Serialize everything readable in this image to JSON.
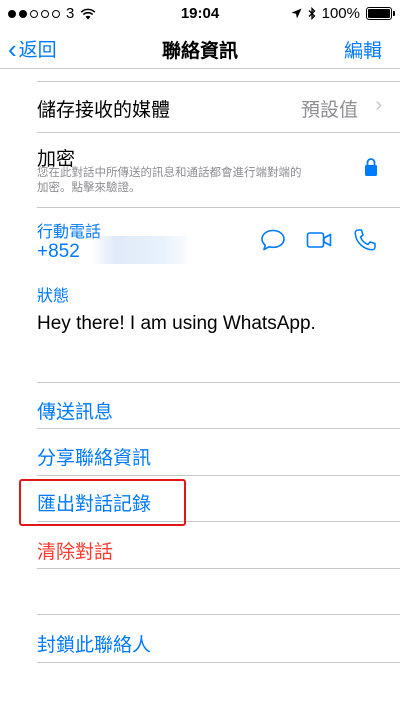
{
  "status_bar": {
    "carrier": "3",
    "time": "19:04",
    "battery": "100%"
  },
  "nav": {
    "back_label": "返回",
    "title": "聯絡資訊",
    "edit_label": "編輯"
  },
  "media": {
    "label": "儲存接收的媒體",
    "value": "預設值"
  },
  "encryption": {
    "title": "加密",
    "description": "您在此對話中所傳送的訊息和通話都會進行端對端的加密。點擊來驗證。"
  },
  "phone": {
    "label": "行動電話",
    "number": "+852"
  },
  "about": {
    "label": "狀態",
    "text": "Hey there! I am using WhatsApp."
  },
  "actions": {
    "send_message": "傳送訊息",
    "share_contact": "分享聯絡資訊",
    "export_chat": "匯出對話記錄",
    "clear_chat": "清除對話",
    "block_contact": "封鎖此聯絡人"
  },
  "colors": {
    "accent": "#007aff",
    "danger": "#ff3b30",
    "highlight": "#e0161a"
  }
}
